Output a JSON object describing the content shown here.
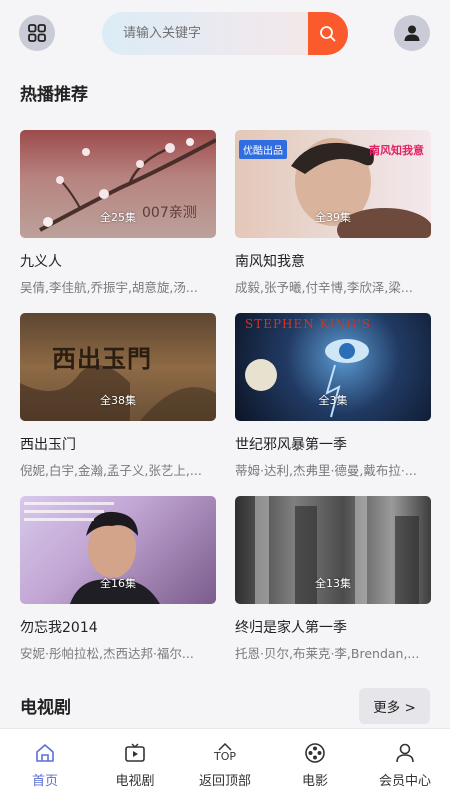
{
  "header": {
    "menu_icon": "grid-icon",
    "search": {
      "placeholder": "请输入关键字",
      "icon": "search-icon",
      "button_color": "#fa5a2c"
    },
    "user_icon": "user-icon"
  },
  "hot": {
    "title": "热播推荐",
    "items": [
      {
        "title": "九义人",
        "episodes": "全25集",
        "cast": "吴倩,李佳航,乔振宇,胡意旋,汤...",
        "poster_text": "007亲测",
        "poster_caption": ""
      },
      {
        "title": "南风知我意",
        "episodes": "全39集",
        "cast": "成毅,张予曦,付辛博,李欣泽,梁...",
        "poster_badge": "优酷出品",
        "poster_logo": "南风知我意"
      },
      {
        "title": "西出玉门",
        "episodes": "全38集",
        "cast": "倪妮,白宇,金瀚,孟子义,张艺上,...",
        "poster_logo": "西出玉門"
      },
      {
        "title": "世纪邪风暴第一季",
        "episodes": "全3集",
        "cast": "蒂姆·达利,杰弗里·德曼,戴布拉·...",
        "poster_logo": "STEPHEN KING'S"
      },
      {
        "title": "勿忘我2014",
        "episodes": "全16集",
        "cast": "安妮·彤帕拉松,杰西达邦·福尔...",
        "poster_text": ""
      },
      {
        "title": "终归是家人第一季",
        "episodes": "全13集",
        "cast": "托恩·贝尔,布莱克·李,Brendan,...",
        "poster_text": ""
      }
    ]
  },
  "tv": {
    "title": "电视剧",
    "more_label": "更多 >"
  },
  "tabbar": {
    "items": [
      {
        "label": "首页",
        "icon": "home-icon",
        "active": true
      },
      {
        "label": "电视剧",
        "icon": "tv-icon",
        "active": false
      },
      {
        "label": "返回顶部",
        "icon": "back-to-top-icon",
        "top_text": "TOP",
        "active": false
      },
      {
        "label": "电影",
        "icon": "film-reel-icon",
        "active": false
      },
      {
        "label": "会员中心",
        "icon": "user-icon",
        "active": false
      }
    ],
    "active_color": "#5b6fd6"
  }
}
